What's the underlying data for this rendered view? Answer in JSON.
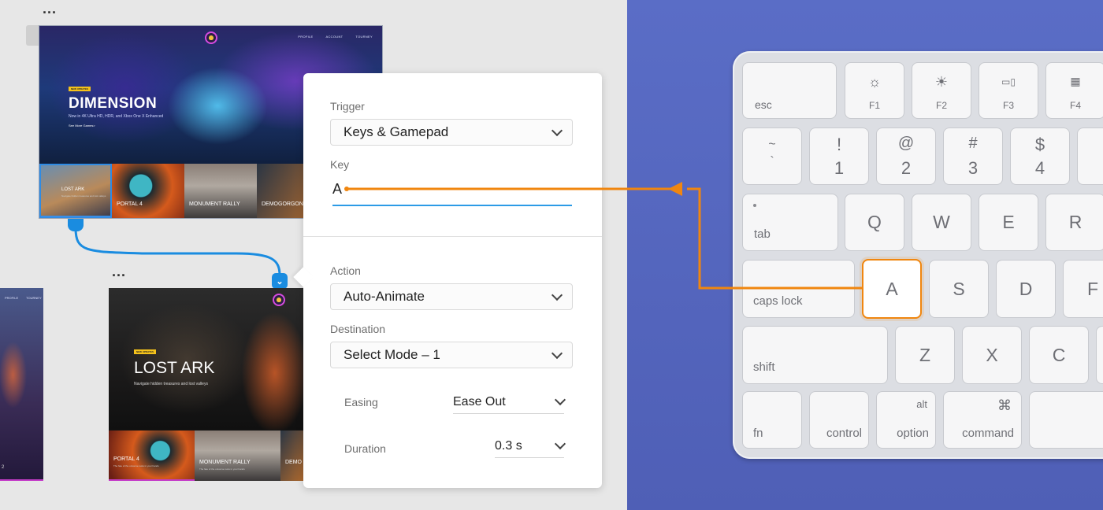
{
  "canvas": {
    "artboard_menu": "...",
    "artboard1": {
      "nav": [
        "PROFILE",
        "ACCOUNT",
        "TOURNEY"
      ],
      "tag": "NEW UPDATES",
      "title": "DIMENSION",
      "subtitle": "Now in 4K Ultra HD, HDR, and Xbox One X Enhanced",
      "more": "See More Games>",
      "tiles": [
        {
          "name": "LOST ARK",
          "desc": "Navigate hidden treasures and lost valleys"
        },
        {
          "name": "PORTAL 4",
          "desc": ""
        },
        {
          "name": "MONUMENT RALLY",
          "desc": ""
        },
        {
          "name": "DEMOGORGON",
          "desc": ""
        }
      ]
    },
    "artboard2": {
      "tag": "NEW UPDATES",
      "title": "LOST ARK",
      "subtitle": "Navigate hidden treasures and lost valleys",
      "tiles": [
        {
          "name": "PORTAL 4",
          "desc": "The fate of the universe rests in your hands"
        },
        {
          "name": "MONUMENT RALLY",
          "desc": "The fate of the universe rests in your hands"
        },
        {
          "name": "DEMO",
          "desc": ""
        }
      ]
    },
    "artboard3": {
      "nav": [
        "PROFILE",
        "TOURNEY"
      ],
      "number": "2"
    }
  },
  "panel": {
    "trigger_label": "Trigger",
    "trigger_value": "Keys & Gamepad",
    "key_label": "Key",
    "key_value": "A",
    "action_label": "Action",
    "action_value": "Auto-Animate",
    "destination_label": "Destination",
    "destination_value": "Select Mode – 1",
    "easing_label": "Easing",
    "easing_value": "Ease Out",
    "duration_label": "Duration",
    "duration_value": "0.3 s"
  },
  "keyboard": {
    "row1": [
      {
        "top": "",
        "bottom": "esc",
        "icon": ""
      },
      {
        "top": "☼",
        "bottom": "F1"
      },
      {
        "top": "☀",
        "bottom": "F2"
      },
      {
        "top": "▭▯",
        "bottom": "F3"
      },
      {
        "top": "▦",
        "bottom": "F4"
      }
    ],
    "row2": [
      {
        "top": "~",
        "bottom": "`"
      },
      {
        "top": "!",
        "bottom": "1"
      },
      {
        "top": "@",
        "bottom": "2"
      },
      {
        "top": "#",
        "bottom": "3"
      },
      {
        "top": "$",
        "bottom": "4"
      },
      {
        "top": "%",
        "bottom": ""
      }
    ],
    "row3": [
      "tab",
      "Q",
      "W",
      "E",
      "R"
    ],
    "row4": [
      "caps lock",
      "A",
      "S",
      "D",
      "F"
    ],
    "row5": [
      "shift",
      "Z",
      "X",
      "C"
    ],
    "row6": [
      {
        "top": "",
        "bottom": "fn"
      },
      {
        "top": "",
        "bottom": "control"
      },
      {
        "top": "alt",
        "bottom": "option"
      },
      {
        "top": "⌘",
        "bottom": "command"
      }
    ],
    "highlight_color": "#f0860f"
  },
  "colors": {
    "accent_blue": "#1a8ce0",
    "accent_orange": "#f0860f",
    "keyboard_bg": "#5566bd"
  }
}
